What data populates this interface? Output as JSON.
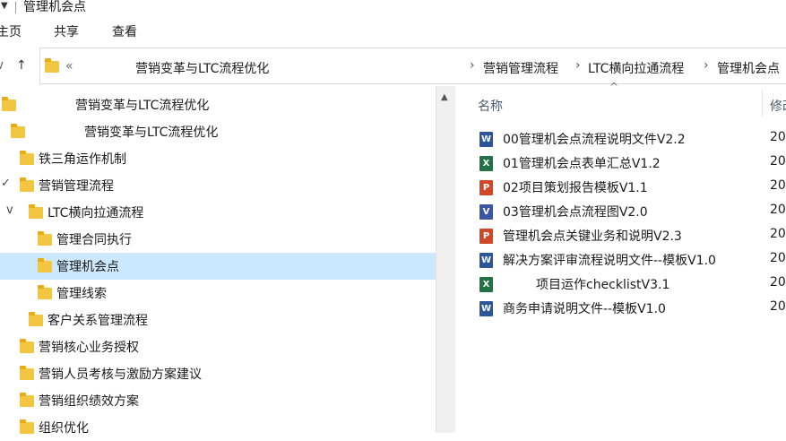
{
  "window": {
    "title": "管理机会点"
  },
  "ribbon": {
    "tabs": [
      "主页",
      "共享",
      "查看"
    ]
  },
  "address": {
    "overflow": "«",
    "crumbs": [
      "营销变革与LTC流程优化",
      "营销管理流程",
      "LTC横向拉通流程",
      "管理机会点"
    ]
  },
  "nav_tree": [
    {
      "label": "营销变革与LTC流程优化",
      "expander": ""
    },
    {
      "label": "营销变革与LTC流程优化",
      "expander": ""
    },
    {
      "label": "铁三角运作机制",
      "expander": ""
    },
    {
      "label": "营销管理流程",
      "expander": "✓"
    },
    {
      "label": "LTC横向拉通流程",
      "expander": "v"
    },
    {
      "label": "管理合同执行",
      "expander": ""
    },
    {
      "label": "管理机会点",
      "expander": "",
      "selected": true
    },
    {
      "label": "管理线索",
      "expander": ""
    },
    {
      "label": "客户关系管理流程",
      "expander": ""
    },
    {
      "label": "营销核心业务授权",
      "expander": ""
    },
    {
      "label": "营销人员考核与激励方案建议",
      "expander": ""
    },
    {
      "label": "营销组织绩效方案",
      "expander": ""
    },
    {
      "label": "组织优化",
      "expander": ""
    }
  ],
  "file_list": {
    "columns": {
      "name": "名称",
      "date": "修改"
    },
    "files": [
      {
        "name": "00管理机会点流程说明文件V2.2",
        "type": "word",
        "date": "20"
      },
      {
        "name": "01管理机会点表单汇总V1.2",
        "type": "excel",
        "date": "20"
      },
      {
        "name": "02项目策划报告模板V1.1",
        "type": "ppt",
        "date": "20"
      },
      {
        "name": "03管理机会点流程图V2.0",
        "type": "visio",
        "date": "20"
      },
      {
        "name": "管理机会点关键业务和说明V2.3",
        "type": "ppt",
        "date": "20"
      },
      {
        "name": "解决方案评审流程说明文件--模板V1.0",
        "type": "word",
        "date": "20"
      },
      {
        "name": "项目运作checklistV3.1",
        "type": "excel",
        "date": "20"
      },
      {
        "name": "商务申请说明文件--模板V1.0",
        "type": "word",
        "date": "20"
      }
    ]
  },
  "icons": {
    "word": "W",
    "excel": "X",
    "ppt": "P",
    "visio": "V"
  },
  "colors": {
    "word": "#2b579a",
    "excel": "#217346",
    "ppt": "#d24726",
    "visio": "#3955a3",
    "folder": "#f3c642",
    "selection": "#cce8ff"
  }
}
